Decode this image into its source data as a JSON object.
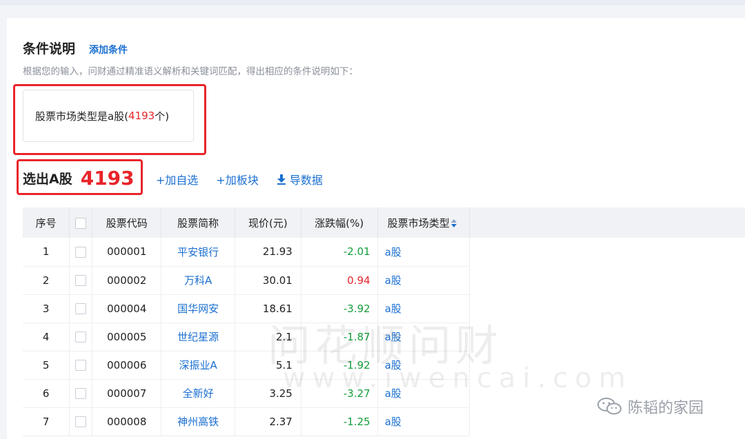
{
  "header": {
    "title": "条件说明",
    "add_condition": "添加条件",
    "description": "根据您的输入，问财通过精准语义解析和关键词匹配，得出相应的条件说明如下："
  },
  "condition": {
    "prefix": "股票市场类型是a股(",
    "count": "4193",
    "suffix": "个)"
  },
  "selection": {
    "label": "选出A股",
    "count": "4193",
    "actions": {
      "add_watchlist": "+加自选",
      "add_sector": "+加板块",
      "export": "导数据"
    }
  },
  "table": {
    "headers": {
      "seq": "序号",
      "code": "股票代码",
      "name": "股票简称",
      "price": "现价(元)",
      "change": "涨跌幅(%)",
      "market_type": "股票市场类型"
    },
    "rows": [
      {
        "seq": "1",
        "code": "000001",
        "name": "平安银行",
        "price": "21.93",
        "change": "-2.01",
        "type": "a股"
      },
      {
        "seq": "2",
        "code": "000002",
        "name": "万科A",
        "price": "30.01",
        "change": "0.94",
        "type": "a股"
      },
      {
        "seq": "3",
        "code": "000004",
        "name": "国华网安",
        "price": "18.61",
        "change": "-3.92",
        "type": "a股"
      },
      {
        "seq": "4",
        "code": "000005",
        "name": "世纪星源",
        "price": "2.1",
        "change": "-1.87",
        "type": "a股"
      },
      {
        "seq": "5",
        "code": "000006",
        "name": "深振业A",
        "price": "5.1",
        "change": "-1.92",
        "type": "a股"
      },
      {
        "seq": "6",
        "code": "000007",
        "name": "全新好",
        "price": "3.25",
        "change": "-3.27",
        "type": "a股"
      },
      {
        "seq": "7",
        "code": "000008",
        "name": "神州高铁",
        "price": "2.37",
        "change": "-1.25",
        "type": "a股"
      }
    ]
  },
  "watermark": {
    "cn": "问花顺问财",
    "url": "www.iwencai.com"
  },
  "wechat": {
    "account": "陈韬的家园"
  },
  "colors": {
    "accent": "#1a6fd1",
    "highlight": "#e8242a",
    "negative": "#139e3a"
  }
}
